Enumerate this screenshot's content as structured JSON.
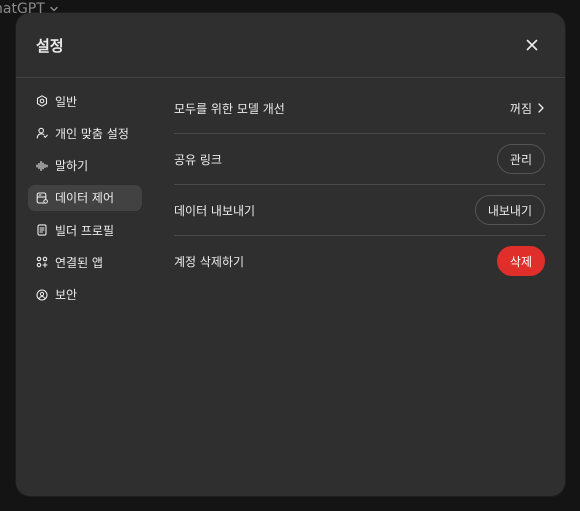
{
  "app": {
    "title": "hatGPT"
  },
  "modal": {
    "title": "설정",
    "close_icon": "close-icon"
  },
  "sidebar": {
    "items": [
      {
        "label": "일반",
        "icon": "gear-icon",
        "active": false
      },
      {
        "label": "개인 맞춤 설정",
        "icon": "person-icon",
        "active": false
      },
      {
        "label": "말하기",
        "icon": "waveform-icon",
        "active": false
      },
      {
        "label": "데이터 제어",
        "icon": "database-icon",
        "active": true
      },
      {
        "label": "빌더 프로필",
        "icon": "id-card-icon",
        "active": false
      },
      {
        "label": "연결된 앱",
        "icon": "apps-icon",
        "active": false
      },
      {
        "label": "보안",
        "icon": "shield-icon",
        "active": false
      }
    ]
  },
  "settings": {
    "improve_model": {
      "label": "모두를 위한 모델 개선",
      "value": "꺼짐"
    },
    "shared_links": {
      "label": "공유 링크",
      "button": "관리"
    },
    "export_data": {
      "label": "데이터 내보내기",
      "button": "내보내기"
    },
    "delete_account": {
      "label": "계정 삭제하기",
      "button": "삭제"
    }
  },
  "colors": {
    "modal_bg": "#2f2f2f",
    "active_item_bg": "#424242",
    "danger": "#e02e2a",
    "divider": "#4a4a4a"
  }
}
